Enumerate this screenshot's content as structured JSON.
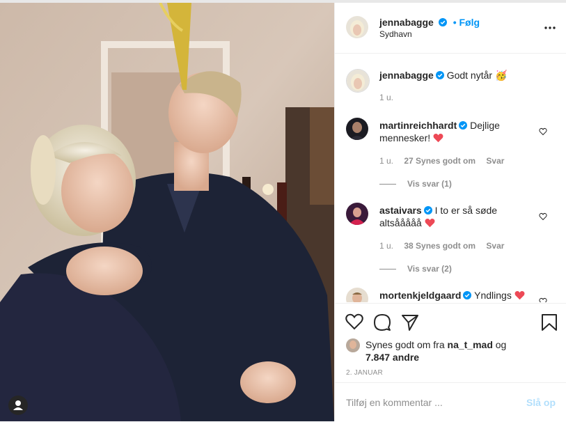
{
  "post": {
    "author": "jennabagge",
    "location": "Sydhavn",
    "follow_label": "• Følg",
    "more_icon": "more-horizontal-icon"
  },
  "caption": {
    "username": "jennabagge",
    "text": "Godt nytår",
    "emoji": "🥳",
    "time": "1 u."
  },
  "comments": [
    {
      "username": "martinreichhardt",
      "text_line1": "Dejlige",
      "text_line2": "mennesker!",
      "time": "1 u.",
      "likes": "27 Synes godt om",
      "reply_label": "Svar",
      "view_replies": "Vis svar (1)"
    },
    {
      "username": "astaivars",
      "text_line1": "I to er så søde",
      "text_line2": "altsååååå",
      "time": "1 u.",
      "likes": "38 Synes godt om",
      "reply_label": "Svar",
      "view_replies": "Vis svar (2)"
    },
    {
      "username": "mortenkjeldgaard",
      "text_line1": "Yndlings"
    }
  ],
  "likes": {
    "prefix": "Synes godt om fra",
    "liker": "na_t_mad",
    "connector": "og",
    "others": "7.847 andre"
  },
  "date": "2. JANUAR",
  "add_comment": {
    "placeholder": "Tilføj en kommentar ...",
    "post_label": "Slå op"
  },
  "colors": {
    "accent": "#0095f6",
    "post_disabled": "#b2dffc",
    "heart_red": "#ed4956"
  }
}
